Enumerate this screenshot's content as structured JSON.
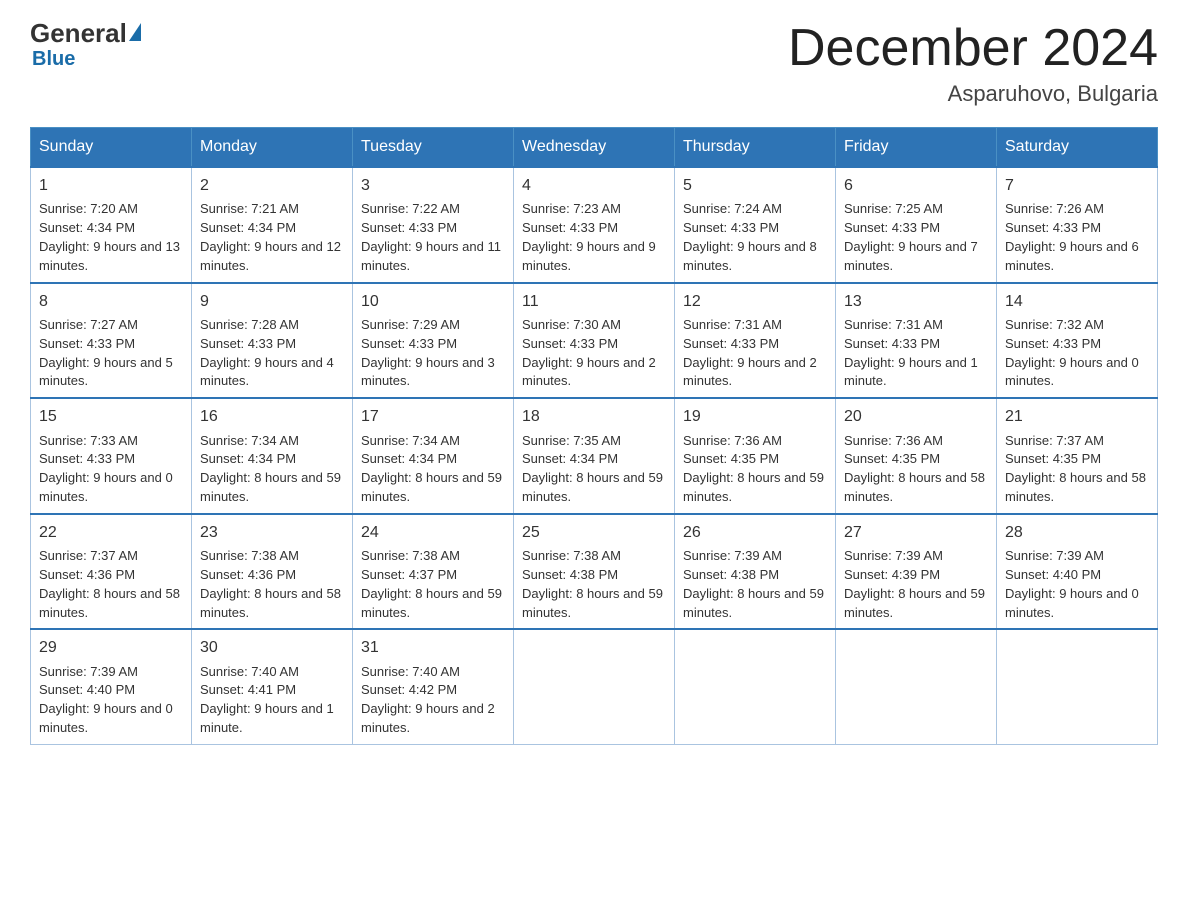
{
  "header": {
    "logo": {
      "general": "General",
      "blue": "Blue",
      "underline": "Blue"
    },
    "title": "December 2024",
    "subtitle": "Asparuhovo, Bulgaria"
  },
  "days": [
    "Sunday",
    "Monday",
    "Tuesday",
    "Wednesday",
    "Thursday",
    "Friday",
    "Saturday"
  ],
  "weeks": [
    [
      {
        "date": "1",
        "sunrise": "7:20 AM",
        "sunset": "4:34 PM",
        "daylight": "9 hours and 13 minutes."
      },
      {
        "date": "2",
        "sunrise": "7:21 AM",
        "sunset": "4:34 PM",
        "daylight": "9 hours and 12 minutes."
      },
      {
        "date": "3",
        "sunrise": "7:22 AM",
        "sunset": "4:33 PM",
        "daylight": "9 hours and 11 minutes."
      },
      {
        "date": "4",
        "sunrise": "7:23 AM",
        "sunset": "4:33 PM",
        "daylight": "9 hours and 9 minutes."
      },
      {
        "date": "5",
        "sunrise": "7:24 AM",
        "sunset": "4:33 PM",
        "daylight": "9 hours and 8 minutes."
      },
      {
        "date": "6",
        "sunrise": "7:25 AM",
        "sunset": "4:33 PM",
        "daylight": "9 hours and 7 minutes."
      },
      {
        "date": "7",
        "sunrise": "7:26 AM",
        "sunset": "4:33 PM",
        "daylight": "9 hours and 6 minutes."
      }
    ],
    [
      {
        "date": "8",
        "sunrise": "7:27 AM",
        "sunset": "4:33 PM",
        "daylight": "9 hours and 5 minutes."
      },
      {
        "date": "9",
        "sunrise": "7:28 AM",
        "sunset": "4:33 PM",
        "daylight": "9 hours and 4 minutes."
      },
      {
        "date": "10",
        "sunrise": "7:29 AM",
        "sunset": "4:33 PM",
        "daylight": "9 hours and 3 minutes."
      },
      {
        "date": "11",
        "sunrise": "7:30 AM",
        "sunset": "4:33 PM",
        "daylight": "9 hours and 2 minutes."
      },
      {
        "date": "12",
        "sunrise": "7:31 AM",
        "sunset": "4:33 PM",
        "daylight": "9 hours and 2 minutes."
      },
      {
        "date": "13",
        "sunrise": "7:31 AM",
        "sunset": "4:33 PM",
        "daylight": "9 hours and 1 minute."
      },
      {
        "date": "14",
        "sunrise": "7:32 AM",
        "sunset": "4:33 PM",
        "daylight": "9 hours and 0 minutes."
      }
    ],
    [
      {
        "date": "15",
        "sunrise": "7:33 AM",
        "sunset": "4:33 PM",
        "daylight": "9 hours and 0 minutes."
      },
      {
        "date": "16",
        "sunrise": "7:34 AM",
        "sunset": "4:34 PM",
        "daylight": "8 hours and 59 minutes."
      },
      {
        "date": "17",
        "sunrise": "7:34 AM",
        "sunset": "4:34 PM",
        "daylight": "8 hours and 59 minutes."
      },
      {
        "date": "18",
        "sunrise": "7:35 AM",
        "sunset": "4:34 PM",
        "daylight": "8 hours and 59 minutes."
      },
      {
        "date": "19",
        "sunrise": "7:36 AM",
        "sunset": "4:35 PM",
        "daylight": "8 hours and 59 minutes."
      },
      {
        "date": "20",
        "sunrise": "7:36 AM",
        "sunset": "4:35 PM",
        "daylight": "8 hours and 58 minutes."
      },
      {
        "date": "21",
        "sunrise": "7:37 AM",
        "sunset": "4:35 PM",
        "daylight": "8 hours and 58 minutes."
      }
    ],
    [
      {
        "date": "22",
        "sunrise": "7:37 AM",
        "sunset": "4:36 PM",
        "daylight": "8 hours and 58 minutes."
      },
      {
        "date": "23",
        "sunrise": "7:38 AM",
        "sunset": "4:36 PM",
        "daylight": "8 hours and 58 minutes."
      },
      {
        "date": "24",
        "sunrise": "7:38 AM",
        "sunset": "4:37 PM",
        "daylight": "8 hours and 59 minutes."
      },
      {
        "date": "25",
        "sunrise": "7:38 AM",
        "sunset": "4:38 PM",
        "daylight": "8 hours and 59 minutes."
      },
      {
        "date": "26",
        "sunrise": "7:39 AM",
        "sunset": "4:38 PM",
        "daylight": "8 hours and 59 minutes."
      },
      {
        "date": "27",
        "sunrise": "7:39 AM",
        "sunset": "4:39 PM",
        "daylight": "8 hours and 59 minutes."
      },
      {
        "date": "28",
        "sunrise": "7:39 AM",
        "sunset": "4:40 PM",
        "daylight": "9 hours and 0 minutes."
      }
    ],
    [
      {
        "date": "29",
        "sunrise": "7:39 AM",
        "sunset": "4:40 PM",
        "daylight": "9 hours and 0 minutes."
      },
      {
        "date": "30",
        "sunrise": "7:40 AM",
        "sunset": "4:41 PM",
        "daylight": "9 hours and 1 minute."
      },
      {
        "date": "31",
        "sunrise": "7:40 AM",
        "sunset": "4:42 PM",
        "daylight": "9 hours and 2 minutes."
      },
      null,
      null,
      null,
      null
    ]
  ],
  "labels": {
    "sunrise": "Sunrise:",
    "sunset": "Sunset:",
    "daylight": "Daylight:"
  }
}
